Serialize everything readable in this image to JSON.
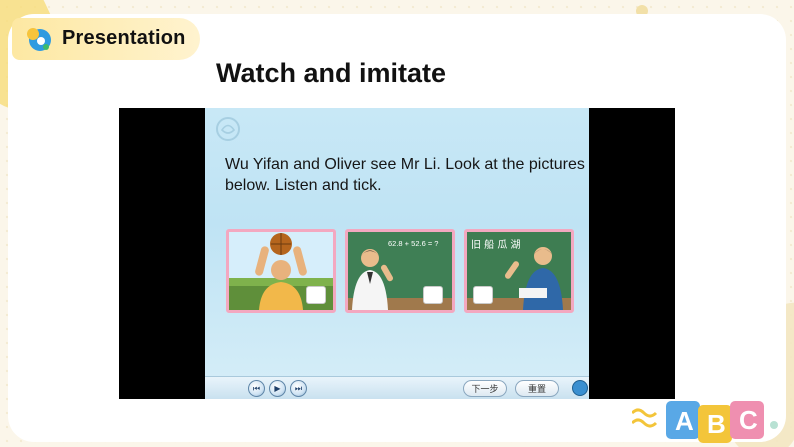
{
  "header": {
    "title": "Presentation"
  },
  "main": {
    "title": "Watch and imitate"
  },
  "slide": {
    "instruction": "Wu Yifan and Oliver see Mr Li. Look at the pictures below. Listen and tick.",
    "pictures": [
      {
        "name": "boy-basketball"
      },
      {
        "name": "teacher-math",
        "board_text": "62.8 + 52.6 = ?"
      },
      {
        "name": "teacher-chinese",
        "board_text": "旧 船 瓜 湖"
      }
    ]
  },
  "controls": {
    "next_label": "下一步",
    "reset_label": "重置"
  },
  "deco": {
    "letters": [
      "A",
      "B",
      "C"
    ]
  },
  "colors": {
    "accent_yellow": "#fde8a2",
    "frame_pink": "#f3a8c0",
    "slide_blue": "#c8e8f6"
  }
}
